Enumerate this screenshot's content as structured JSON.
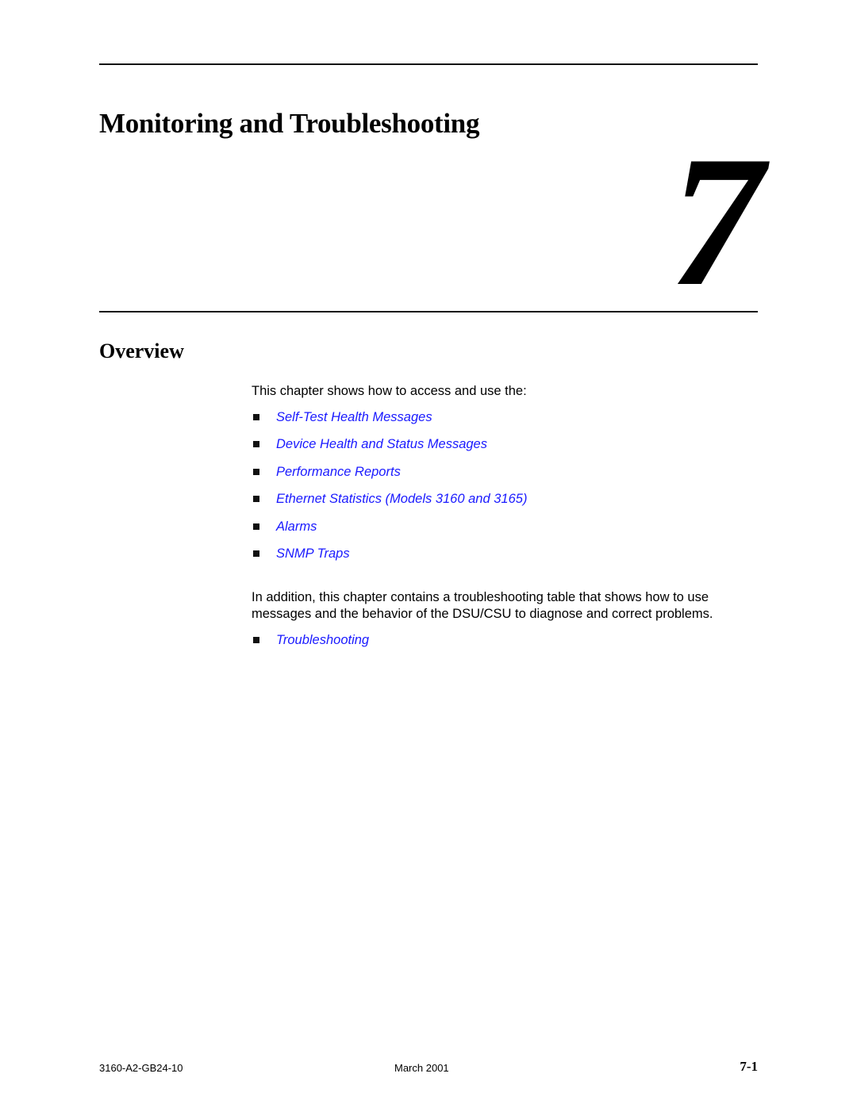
{
  "chapter": {
    "title": "Monitoring and Troubleshooting",
    "number": "7"
  },
  "section": {
    "title": "Overview",
    "intro": "This chapter shows how to access and use the:",
    "links": [
      "Self-Test Health Messages",
      "Device Health and Status Messages",
      "Performance Reports",
      "Ethernet Statistics (Models 3160 and 3165)",
      "Alarms",
      "SNMP Traps"
    ],
    "addition": "In addition, this chapter contains a troubleshooting table that shows how to use messages and the behavior of the DSU/CSU to diagnose and correct problems.",
    "troubleshooting_link": "Troubleshooting"
  },
  "colors": {
    "link": "#1a1aff",
    "text": "#000000",
    "rule": "#111111"
  },
  "footer": {
    "doc_number": "3160-A2-GB24-10",
    "date": "March 2001",
    "page": "7-1"
  }
}
